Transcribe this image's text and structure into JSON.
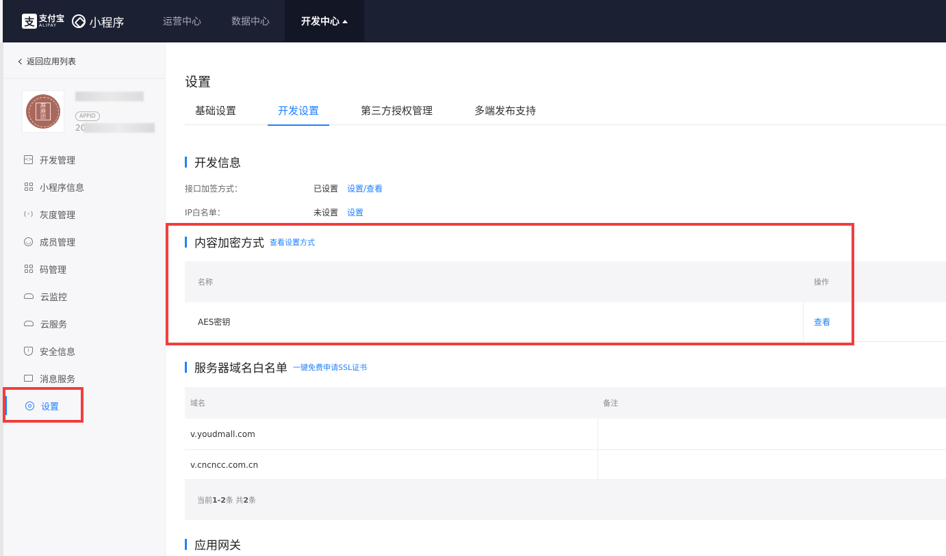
{
  "header": {
    "brand_cn": "支付宝",
    "brand_en": "ALIPAY",
    "brand_mark": "支",
    "product": "小程序",
    "nav": [
      {
        "label": "运营中心"
      },
      {
        "label": "数据中心"
      },
      {
        "label": "开发中心",
        "active": true
      }
    ]
  },
  "sidebar": {
    "back_label": "返回应用列表",
    "app": {
      "logo_chars": [
        "麻",
        "麻",
        "团"
      ],
      "appid_badge": "APPID",
      "appid_prefix": "20"
    },
    "items": [
      {
        "label": "开发管理",
        "icon": "code-icon"
      },
      {
        "label": "小程序信息",
        "icon": "grid-icon"
      },
      {
        "label": "灰度管理",
        "icon": "signal-icon"
      },
      {
        "label": "成员管理",
        "icon": "user-icon"
      },
      {
        "label": "码管理",
        "icon": "qrcode-icon"
      },
      {
        "label": "云监控",
        "icon": "cloud-icon"
      },
      {
        "label": "云服务",
        "icon": "cloud-icon"
      },
      {
        "label": "安全信息",
        "icon": "shield-icon"
      },
      {
        "label": "消息服务",
        "icon": "monitor-icon"
      },
      {
        "label": "设置",
        "icon": "gear-icon",
        "active": true
      }
    ]
  },
  "main": {
    "page_title": "设置",
    "tabs": [
      {
        "label": "基础设置"
      },
      {
        "label": "开发设置",
        "active": true
      },
      {
        "label": "第三方授权管理"
      },
      {
        "label": "多端发布支持"
      }
    ],
    "dev_info": {
      "title": "开发信息",
      "rows": [
        {
          "label": "接口加签方式：",
          "value": "已设置",
          "link": "设置/查看"
        },
        {
          "label": "IP白名单：",
          "value": "未设置",
          "link": "设置"
        }
      ]
    },
    "content_encrypt": {
      "title": "内容加密方式",
      "link": "查看设置方式",
      "columns": [
        "名称",
        "操作"
      ],
      "rows": [
        {
          "name": "AES密钥",
          "action": "查看"
        }
      ]
    },
    "server_whitelist": {
      "title": "服务器域名白名单",
      "link": "一键免费申请SSL证书",
      "columns": [
        "域名",
        "备注"
      ],
      "rows": [
        {
          "domain": "v.youdmall.com",
          "note": ""
        },
        {
          "domain": "v.cncncc.com.cn",
          "note": ""
        }
      ],
      "pagination": {
        "prefix": "当前",
        "range": "1-2",
        "mid": "条 共",
        "total": "2",
        "suffix": "条"
      }
    },
    "gateway": {
      "title": "应用网关"
    }
  }
}
